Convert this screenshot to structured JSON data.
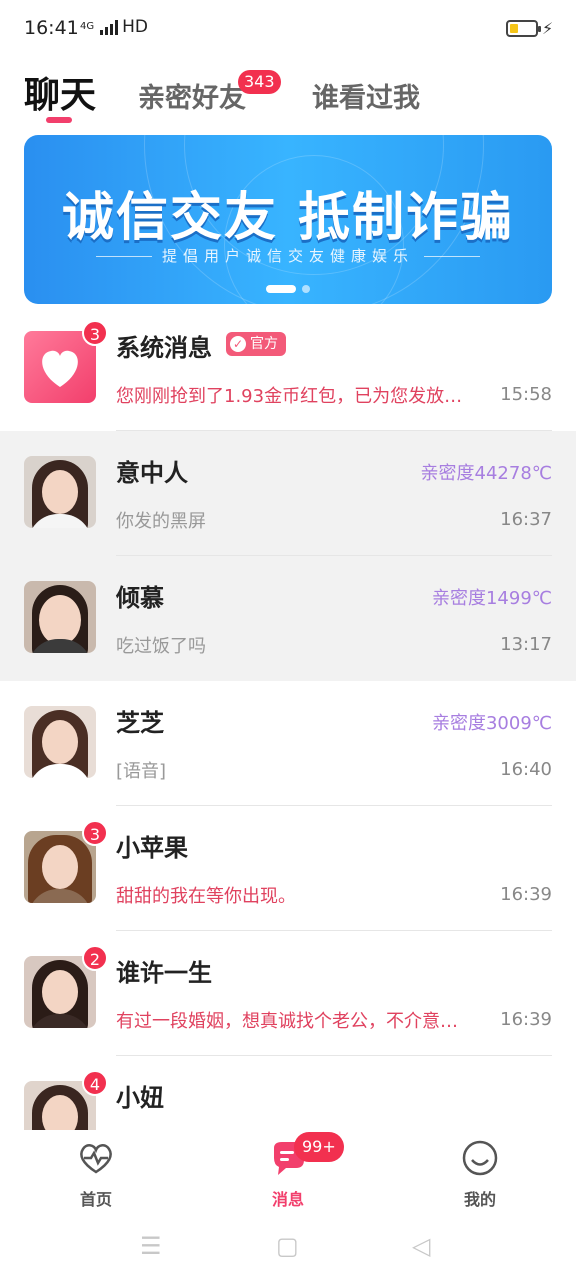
{
  "status_bar": {
    "time": "16:41",
    "network": "4G",
    "hd": "HD"
  },
  "tabs": [
    {
      "label": "聊天"
    },
    {
      "label": "亲密好友",
      "badge": "343"
    },
    {
      "label": "谁看过我"
    }
  ],
  "banner": {
    "title": "诚信交友 抵制诈骗",
    "subtitle": "提倡用户诚信交友健康娱乐"
  },
  "chats": [
    {
      "name": "系统消息",
      "tag": "官方",
      "badge": "3",
      "message": "您刚刚抢到了1.93金币红包，已为您发放…",
      "time": "15:58"
    },
    {
      "name": "意中人",
      "intimacy": "亲密度44278℃",
      "message": "你发的黑屏",
      "time": "16:37"
    },
    {
      "name": "倾慕",
      "intimacy": "亲密度1499℃",
      "message": "吃过饭了吗",
      "time": "13:17"
    },
    {
      "name": "芝芝",
      "intimacy": "亲密度3009℃",
      "message": "[语音]",
      "time": "16:40"
    },
    {
      "name": "小苹果",
      "badge": "3",
      "message": "甜甜的我在等你出现。",
      "time": "16:39"
    },
    {
      "name": "谁许一生",
      "badge": "2",
      "message": "有过一段婚姻，想真诚找个老公，不介意…",
      "time": "16:39"
    },
    {
      "name": "小妞",
      "badge": "4"
    }
  ],
  "bottom_nav": [
    {
      "label": "首页",
      "icon": "heartbeat-icon"
    },
    {
      "label": "消息",
      "icon": "message-icon",
      "badge": "99+"
    },
    {
      "label": "我的",
      "icon": "smile-face-icon"
    }
  ],
  "colors": {
    "accent": "#f23f6c",
    "intimacy": "#a77ee0",
    "badge": "#f2304f",
    "banner": "#38b4ff"
  }
}
